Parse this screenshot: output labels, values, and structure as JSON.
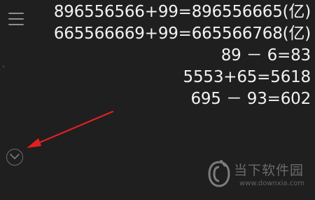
{
  "menu": {
    "icon": "hamburger-menu-icon"
  },
  "history": [
    "896556566+99=896556665(亿)",
    "665566669+99=665566768(亿)",
    "89 － 6=83",
    "5553+65=5618",
    "695 － 93=602"
  ],
  "expand": {
    "icon": "chevron-down-circle-icon"
  },
  "annotation": {
    "icon": "red-arrow-icon",
    "color": "#e02020"
  },
  "watermark": {
    "brand": "当下软件园",
    "url": "www.downxia.com"
  }
}
